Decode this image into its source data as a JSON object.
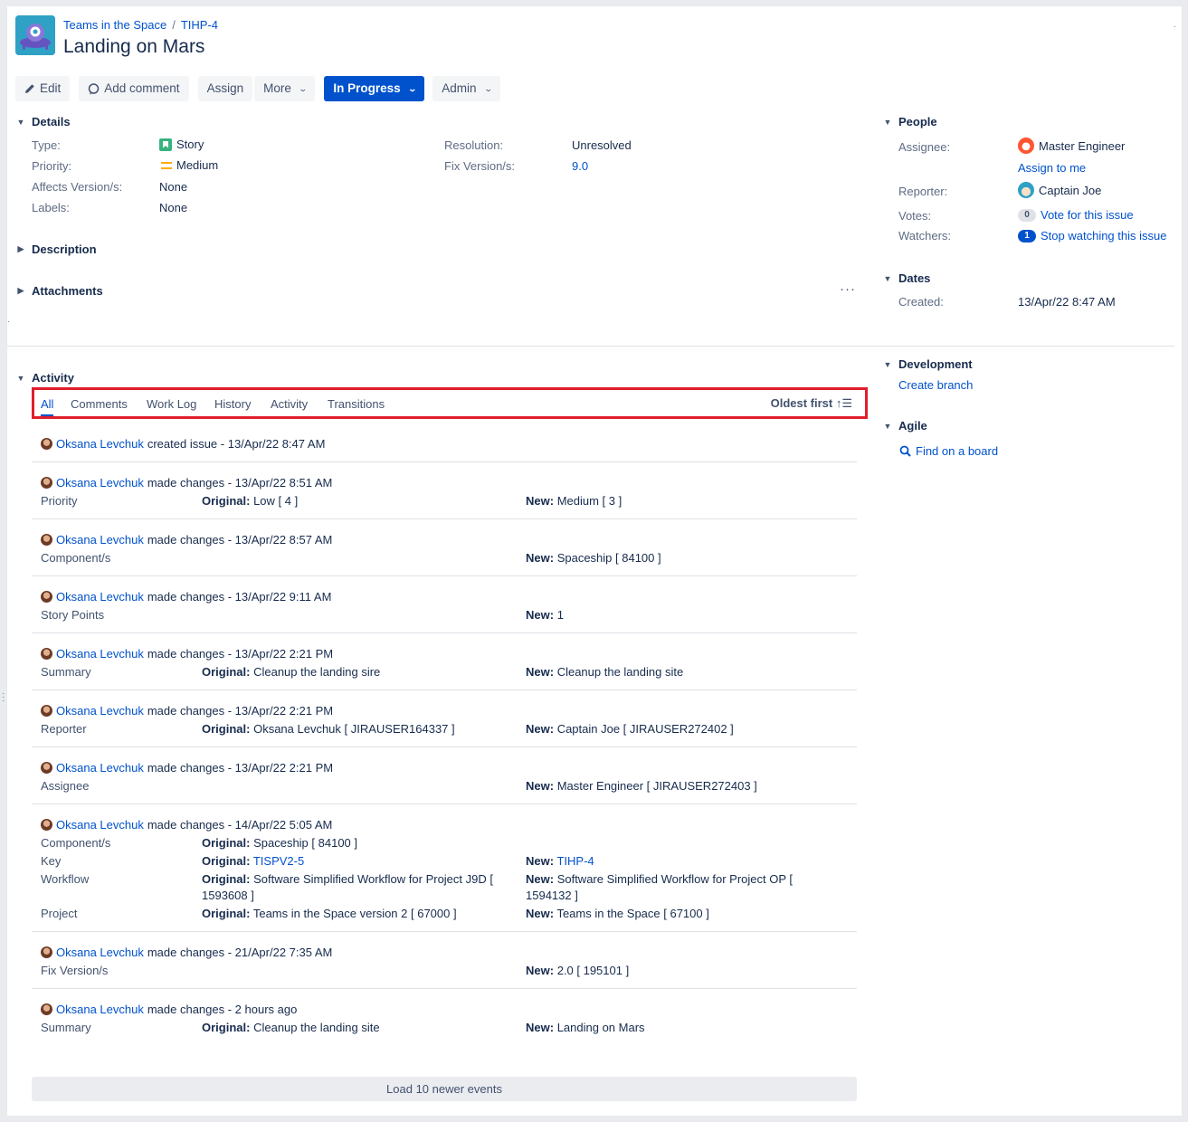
{
  "header": {
    "breadcrumb_project": "Teams in the Space",
    "breadcrumb_sep": "/",
    "breadcrumb_issue": "TIHP-4",
    "title": "Landing on Mars"
  },
  "toolbar": {
    "edit": "Edit",
    "add_comment": "Add comment",
    "assign": "Assign",
    "more": "More",
    "status": "In Progress",
    "admin": "Admin"
  },
  "details": {
    "heading": "Details",
    "type_label": "Type:",
    "type_value": "Story",
    "priority_label": "Priority:",
    "priority_value": "Medium",
    "affects_label": "Affects Version/s:",
    "affects_value": "None",
    "labels_label": "Labels:",
    "labels_value": "None",
    "resolution_label": "Resolution:",
    "resolution_value": "Unresolved",
    "fix_label": "Fix Version/s:",
    "fix_value": "9.0"
  },
  "description": {
    "heading": "Description"
  },
  "attachments": {
    "heading": "Attachments",
    "more": "···"
  },
  "people": {
    "heading": "People",
    "assignee_label": "Assignee:",
    "assignee_value": "Master Engineer",
    "assign_to_me": "Assign to me",
    "reporter_label": "Reporter:",
    "reporter_value": "Captain Joe",
    "votes_label": "Votes:",
    "votes_count": "0",
    "vote_link": "Vote for this issue",
    "watchers_label": "Watchers:",
    "watchers_count": "1",
    "watch_link": "Stop watching this issue"
  },
  "dates": {
    "heading": "Dates",
    "created_label": "Created:",
    "created_value": "13/Apr/22 8:47 AM"
  },
  "development": {
    "heading": "Development",
    "create_branch": "Create branch"
  },
  "agile": {
    "heading": "Agile",
    "find_board": "Find on a board"
  },
  "activity": {
    "heading": "Activity",
    "tabs": [
      "All",
      "Comments",
      "Work Log",
      "History",
      "Activity",
      "Transitions"
    ],
    "sort": "Oldest first",
    "load_more": "Load 10 newer events",
    "entries": [
      {
        "user": "Oksana Levchuk",
        "action": "created issue - 13/Apr/22 8:47 AM",
        "rows": []
      },
      {
        "user": "Oksana Levchuk",
        "action": "made changes - 13/Apr/22 8:51 AM",
        "rows": [
          {
            "field": "Priority",
            "original": "Low [ 4 ]",
            "new": "Medium [ 3 ]"
          }
        ]
      },
      {
        "user": "Oksana Levchuk",
        "action": "made changes - 13/Apr/22 8:57 AM",
        "rows": [
          {
            "field": "Component/s",
            "original": "",
            "new": "Spaceship [ 84100 ]"
          }
        ]
      },
      {
        "user": "Oksana Levchuk",
        "action": "made changes - 13/Apr/22 9:11 AM",
        "rows": [
          {
            "field": "Story Points",
            "original": "",
            "new": "1"
          }
        ]
      },
      {
        "user": "Oksana Levchuk",
        "action": "made changes - 13/Apr/22 2:21 PM",
        "rows": [
          {
            "field": "Summary",
            "original": "Cleanup the landing sire",
            "new": "Cleanup the landing site"
          }
        ]
      },
      {
        "user": "Oksana Levchuk",
        "action": "made changes - 13/Apr/22 2:21 PM",
        "rows": [
          {
            "field": "Reporter",
            "original": "Oksana Levchuk [ JIRAUSER164337 ]",
            "new": "Captain Joe [ JIRAUSER272402 ]"
          }
        ]
      },
      {
        "user": "Oksana Levchuk",
        "action": "made changes - 13/Apr/22 2:21 PM",
        "rows": [
          {
            "field": "Assignee",
            "original": "",
            "new": "Master Engineer [ JIRAUSER272403 ]"
          }
        ]
      },
      {
        "user": "Oksana Levchuk",
        "action": "made changes - 14/Apr/22 5:05 AM",
        "rows": [
          {
            "field": "Component/s",
            "original": "Spaceship [ 84100 ]",
            "new": ""
          },
          {
            "field": "Key",
            "original": "TISPV2-5",
            "new": "TIHP-4",
            "links": true
          },
          {
            "field": "Workflow",
            "original": "Software Simplified Workflow for Project J9D [ 1593608 ]",
            "new": "Software Simplified Workflow for Project OP [ 1594132 ]"
          },
          {
            "field": "Project",
            "original": "Teams in the Space version 2 [ 67000 ]",
            "new": "Teams in the Space [ 67100 ]"
          }
        ]
      },
      {
        "user": "Oksana Levchuk",
        "action": "made changes - 21/Apr/22 7:35 AM",
        "rows": [
          {
            "field": "Fix Version/s",
            "original": "",
            "new": "2.0 [ 195101 ]"
          }
        ]
      },
      {
        "user": "Oksana Levchuk",
        "action": "made changes - 2 hours ago",
        "rows": [
          {
            "field": "Summary",
            "original": "Cleanup the landing site",
            "new": "Landing on Mars"
          }
        ]
      }
    ],
    "original_prefix": "Original:",
    "new_prefix": "New:"
  }
}
